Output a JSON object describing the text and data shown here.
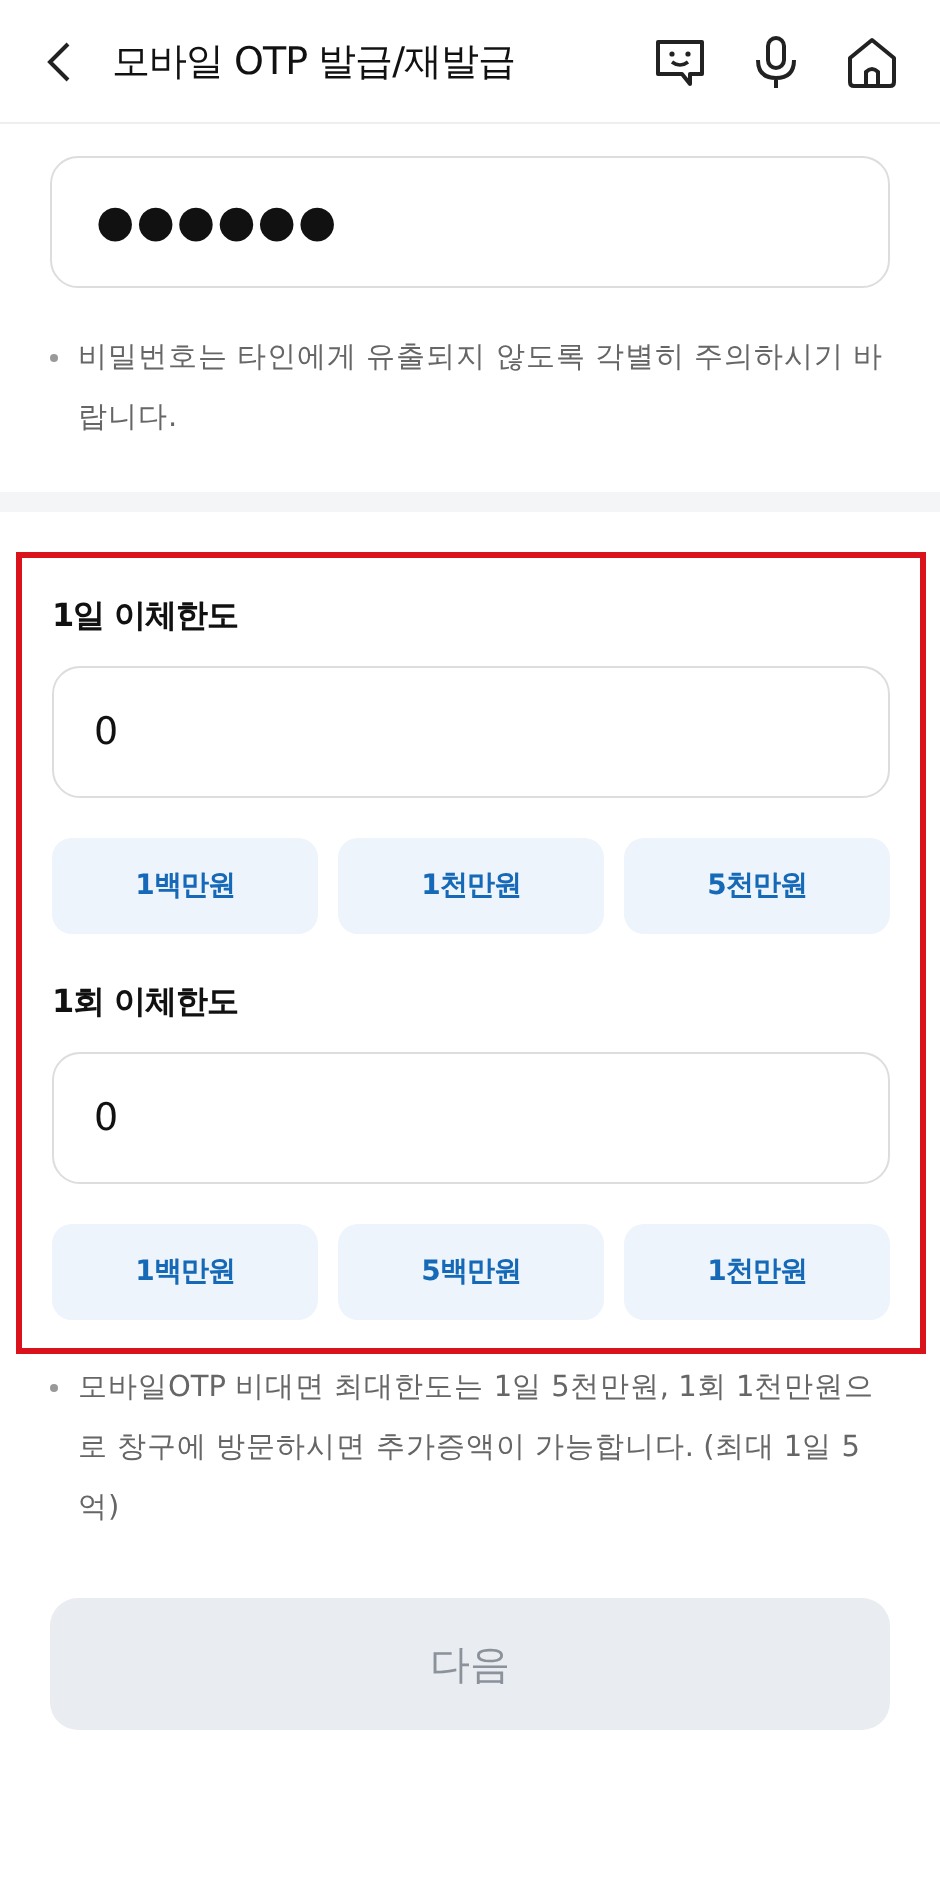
{
  "header": {
    "title": "모바일 OTP 발급/재발급"
  },
  "password": {
    "value": "●●●●●●",
    "note": "비밀번호는 타인에게 유출되지 않도록 각별히 주의하시기 바랍니다."
  },
  "limits": [
    {
      "label": "1일 이체한도",
      "value": "0",
      "presets": [
        "1백만원",
        "1천만원",
        "5천만원"
      ]
    },
    {
      "label": "1회 이체한도",
      "value": "0",
      "presets": [
        "1백만원",
        "5백만원",
        "1천만원"
      ]
    }
  ],
  "note": "모바일OTP 비대면 최대한도는 1일 5천만원, 1회 1천만원으로 창구에 방문하시면 추가증액이 가능합니다. (최대 1일 5억)",
  "next_button": {
    "label": "다음",
    "disabled": true
  }
}
